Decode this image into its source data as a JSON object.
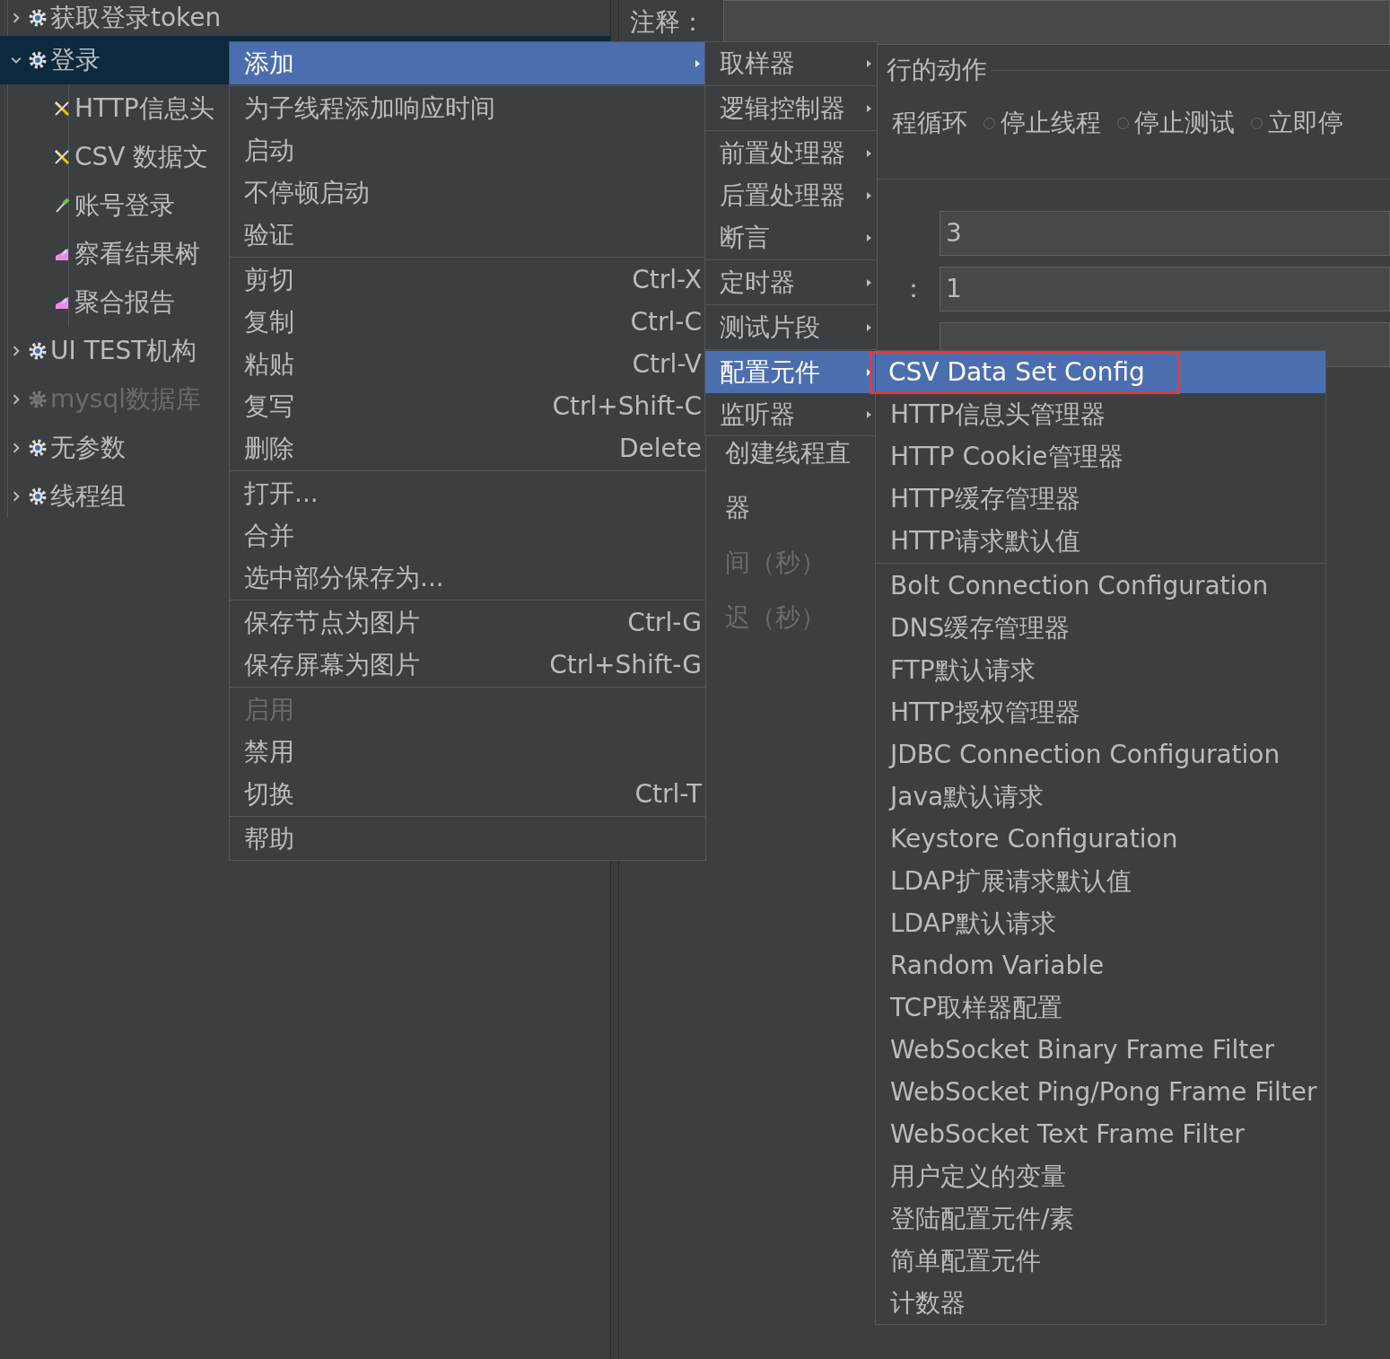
{
  "tree": [
    {
      "label": "获取登录token",
      "kind": "thread_group",
      "expanded": false,
      "selected": false,
      "disabled": false
    },
    {
      "label": "登录",
      "kind": "thread_group",
      "expanded": true,
      "selected": true,
      "disabled": false,
      "children": [
        {
          "label": "HTTP信息头",
          "kind": "config",
          "selected": false,
          "disabled": false
        },
        {
          "label": "CSV 数据文",
          "kind": "config",
          "selected": false,
          "disabled": false
        },
        {
          "label": "账号登录",
          "kind": "sampler",
          "selected": false,
          "disabled": false
        },
        {
          "label": "察看结果树",
          "kind": "listener",
          "selected": false,
          "disabled": false
        },
        {
          "label": "聚合报告",
          "kind": "listener",
          "selected": false,
          "disabled": false
        }
      ]
    },
    {
      "label": "UI TEST机构",
      "kind": "thread_group",
      "expanded": false,
      "selected": false,
      "disabled": false
    },
    {
      "label": "mysql数据库",
      "kind": "thread_group",
      "expanded": false,
      "selected": false,
      "disabled": true
    },
    {
      "label": "无参数",
      "kind": "thread_group",
      "expanded": false,
      "selected": false,
      "disabled": false
    },
    {
      "label": "线程组",
      "kind": "thread_group",
      "expanded": false,
      "selected": false,
      "disabled": false
    }
  ],
  "details": {
    "comment_label": "注释：",
    "action_group_title": "行的动作",
    "action_cut_label": "程循环",
    "action_options": [
      {
        "label": "停止线程",
        "selected": false
      },
      {
        "label": "停止测试",
        "selected": false
      },
      {
        "label": "立即停",
        "selected": false
      }
    ],
    "fields": [
      {
        "value": "3"
      },
      {
        "label": "：",
        "value": "1"
      }
    ],
    "lower_labels": [
      {
        "text": "创建线程直",
        "disabled": false
      },
      {
        "text": "器",
        "disabled": false
      },
      {
        "text": "间（秒）",
        "disabled": true
      },
      {
        "text": "迟（秒）",
        "disabled": true
      }
    ]
  },
  "context_menu": {
    "groups": [
      [
        {
          "label": "添加",
          "submenu": true,
          "selected": true,
          "disabled": false
        }
      ],
      [
        {
          "label": "为子线程添加响应时间",
          "selected": false,
          "disabled": false
        },
        {
          "label": "启动",
          "selected": false,
          "disabled": false
        },
        {
          "label": "不停顿启动",
          "selected": false,
          "disabled": false
        },
        {
          "label": "验证",
          "selected": false,
          "disabled": false
        }
      ],
      [
        {
          "label": "剪切",
          "shortcut": "Ctrl-X",
          "selected": false,
          "disabled": false
        },
        {
          "label": "复制",
          "shortcut": "Ctrl-C",
          "selected": false,
          "disabled": false
        },
        {
          "label": "粘贴",
          "shortcut": "Ctrl-V",
          "selected": false,
          "disabled": false
        },
        {
          "label": "复写",
          "shortcut": "Ctrl+Shift-C",
          "selected": false,
          "disabled": false
        },
        {
          "label": "删除",
          "shortcut": "Delete",
          "selected": false,
          "disabled": false
        }
      ],
      [
        {
          "label": "打开...",
          "selected": false,
          "disabled": false
        },
        {
          "label": "合并",
          "selected": false,
          "disabled": false
        },
        {
          "label": "选中部分保存为...",
          "selected": false,
          "disabled": false
        }
      ],
      [
        {
          "label": "保存节点为图片",
          "shortcut": "Ctrl-G",
          "selected": false,
          "disabled": false
        },
        {
          "label": "保存屏幕为图片",
          "shortcut": "Ctrl+Shift-G",
          "selected": false,
          "disabled": false
        }
      ],
      [
        {
          "label": "启用",
          "selected": false,
          "disabled": true
        },
        {
          "label": "禁用",
          "selected": false,
          "disabled": false
        },
        {
          "label": "切换",
          "shortcut": "Ctrl-T",
          "selected": false,
          "disabled": false
        }
      ],
      [
        {
          "label": "帮助",
          "selected": false,
          "disabled": false
        }
      ]
    ]
  },
  "add_submenu": {
    "groups": [
      [
        {
          "label": "取样器",
          "submenu": true,
          "selected": false,
          "disabled": false
        }
      ],
      [
        {
          "label": "逻辑控制器",
          "submenu": true,
          "selected": false,
          "disabled": false
        }
      ],
      [
        {
          "label": "前置处理器",
          "submenu": true,
          "selected": false,
          "disabled": false
        },
        {
          "label": "后置处理器",
          "submenu": true,
          "selected": false,
          "disabled": false
        },
        {
          "label": "断言",
          "submenu": true,
          "selected": false,
          "disabled": false
        }
      ],
      [
        {
          "label": "定时器",
          "submenu": true,
          "selected": false,
          "disabled": false
        }
      ],
      [
        {
          "label": "测试片段",
          "submenu": true,
          "selected": false,
          "disabled": false
        }
      ],
      [
        {
          "label": "配置元件",
          "submenu": true,
          "selected": true,
          "disabled": false
        },
        {
          "label": "监听器",
          "submenu": true,
          "selected": false,
          "disabled": false
        }
      ]
    ]
  },
  "config_submenu": {
    "groups": [
      [
        {
          "label": "CSV Data Set Config",
          "selected": true,
          "disabled": false,
          "annotated": true
        },
        {
          "label": "HTTP信息头管理器",
          "selected": false,
          "disabled": false,
          "annotated": false
        },
        {
          "label": "HTTP Cookie管理器",
          "selected": false,
          "disabled": false,
          "annotated": false
        },
        {
          "label": "HTTP缓存管理器",
          "selected": false,
          "disabled": false,
          "annotated": false
        },
        {
          "label": "HTTP请求默认值",
          "selected": false,
          "disabled": false,
          "annotated": false
        }
      ],
      [
        {
          "label": "Bolt Connection Configuration",
          "selected": false,
          "disabled": false,
          "annotated": false
        },
        {
          "label": "DNS缓存管理器",
          "selected": false,
          "disabled": false,
          "annotated": false
        },
        {
          "label": "FTP默认请求",
          "selected": false,
          "disabled": false,
          "annotated": false
        },
        {
          "label": "HTTP授权管理器",
          "selected": false,
          "disabled": false,
          "annotated": false
        },
        {
          "label": "JDBC Connection Configuration",
          "selected": false,
          "disabled": false,
          "annotated": false
        },
        {
          "label": "Java默认请求",
          "selected": false,
          "disabled": false,
          "annotated": false
        },
        {
          "label": "Keystore Configuration",
          "selected": false,
          "disabled": false,
          "annotated": false
        },
        {
          "label": "LDAP扩展请求默认值",
          "selected": false,
          "disabled": false,
          "annotated": false
        },
        {
          "label": "LDAP默认请求",
          "selected": false,
          "disabled": false,
          "annotated": false
        },
        {
          "label": "Random Variable",
          "selected": false,
          "disabled": false,
          "annotated": false
        },
        {
          "label": "TCP取样器配置",
          "selected": false,
          "disabled": false,
          "annotated": false
        },
        {
          "label": "WebSocket Binary Frame Filter",
          "selected": false,
          "disabled": false,
          "annotated": false
        },
        {
          "label": "WebSocket Ping/Pong Frame Filter",
          "selected": false,
          "disabled": false,
          "annotated": false
        },
        {
          "label": "WebSocket Text Frame Filter",
          "selected": false,
          "disabled": false,
          "annotated": false
        },
        {
          "label": "用户定义的变量",
          "selected": false,
          "disabled": false,
          "annotated": false
        },
        {
          "label": "登陆配置元件/素",
          "selected": false,
          "disabled": false,
          "annotated": false
        },
        {
          "label": "简单配置元件",
          "selected": false,
          "disabled": false,
          "annotated": false
        },
        {
          "label": "计数器",
          "selected": false,
          "disabled": false,
          "annotated": false
        }
      ]
    ]
  }
}
